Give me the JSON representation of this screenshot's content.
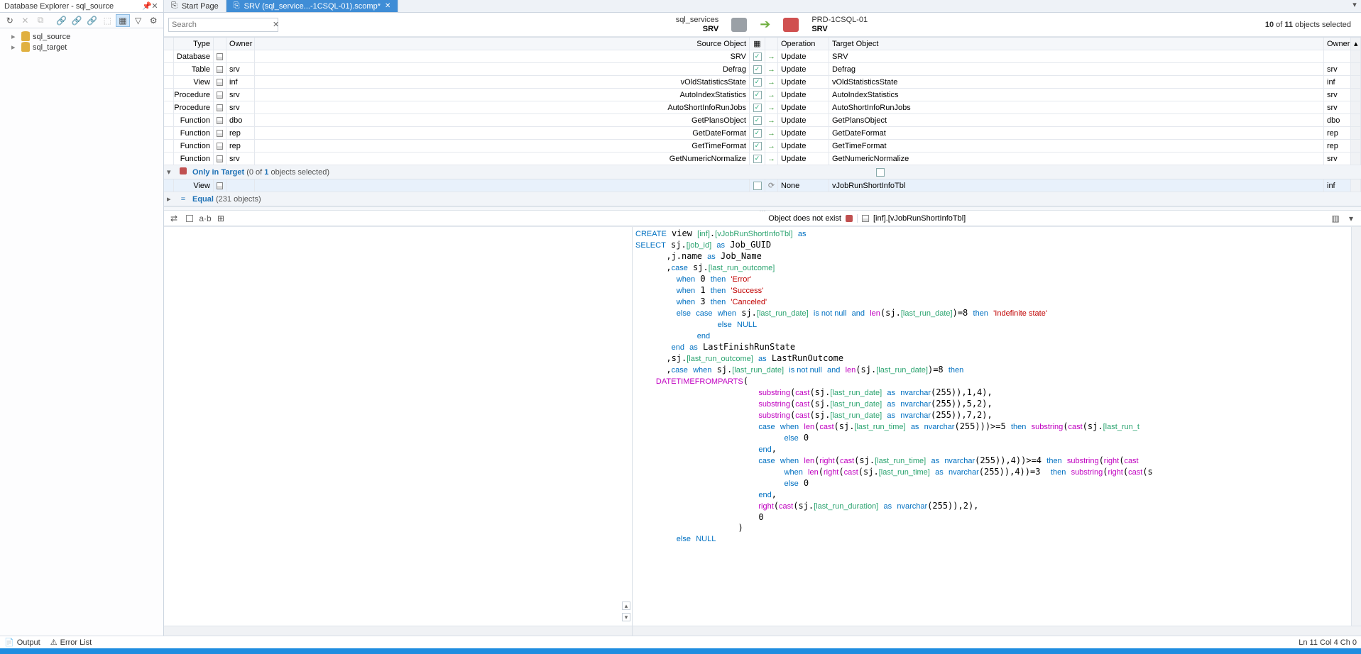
{
  "explorer_title": "Database Explorer - sql_source",
  "doc_tabs": [
    {
      "label": "Start Page",
      "active": false
    },
    {
      "label": "SRV (sql_service...-1CSQL-01).scomp*",
      "active": true
    }
  ],
  "tree": [
    {
      "label": "sql_source"
    },
    {
      "label": "sql_target"
    }
  ],
  "search_placeholder": "Search",
  "source": {
    "name": "sql_services",
    "node": "SRV"
  },
  "target": {
    "name": "PRD-1CSQL-01",
    "node": "SRV"
  },
  "count_html": {
    "a": "10",
    "b": "11",
    "suffix": "objects selected"
  },
  "columns": {
    "type": "Type",
    "owner": "Owner",
    "srcobj": "Source Object",
    "op": "Operation",
    "tgt": "Target Object",
    "towner": "Owner"
  },
  "rows": [
    {
      "type": "Database",
      "owner": "",
      "src": "SRV",
      "chk": true,
      "op": "Update",
      "tgt": "SRV",
      "towner": ""
    },
    {
      "type": "Table",
      "owner": "srv",
      "src": "Defrag",
      "chk": true,
      "op": "Update",
      "tgt": "Defrag",
      "towner": "srv"
    },
    {
      "type": "View",
      "owner": "inf",
      "src": "vOldStatisticsState",
      "chk": true,
      "op": "Update",
      "tgt": "vOldStatisticsState",
      "towner": "inf"
    },
    {
      "type": "Procedure",
      "owner": "srv",
      "src": "AutoIndexStatistics",
      "chk": true,
      "op": "Update",
      "tgt": "AutoIndexStatistics",
      "towner": "srv"
    },
    {
      "type": "Procedure",
      "owner": "srv",
      "src": "AutoShortInfoRunJobs",
      "chk": true,
      "op": "Update",
      "tgt": "AutoShortInfoRunJobs",
      "towner": "srv"
    },
    {
      "type": "Function",
      "owner": "dbo",
      "src": "GetPlansObject",
      "chk": true,
      "op": "Update",
      "tgt": "GetPlansObject",
      "towner": "dbo"
    },
    {
      "type": "Function",
      "owner": "rep",
      "src": "GetDateFormat",
      "chk": true,
      "op": "Update",
      "tgt": "GetDateFormat",
      "towner": "rep"
    },
    {
      "type": "Function",
      "owner": "rep",
      "src": "GetTimeFormat",
      "chk": true,
      "op": "Update",
      "tgt": "GetTimeFormat",
      "towner": "rep"
    },
    {
      "type": "Function",
      "owner": "srv",
      "src": "GetNumericNormalize",
      "chk": true,
      "op": "Update",
      "tgt": "GetNumericNormalize",
      "towner": "srv"
    }
  ],
  "only_target": {
    "label": "Only in Target",
    "detail_prefix": "(0 of ",
    "detail_n": "1",
    "detail_suffix": " objects selected)"
  },
  "only_target_row": {
    "type": "View",
    "op": "None",
    "tgt": "vJobRunShortInfoTbl",
    "towner": "inf"
  },
  "equal": {
    "label": "Equal",
    "count": "(231 objects)"
  },
  "left_diff_msg": "Object does not exist",
  "right_diff_title": "[inf].[vJobRunShortInfoTbl]",
  "status": {
    "output": "Output",
    "errors": "Error List",
    "pos": "Ln 11    Col 4    Ch 0"
  },
  "sql_lines": [
    [
      {
        "t": "CREATE",
        "c": "kw"
      },
      {
        "t": " view "
      },
      {
        "t": "[inf]",
        "c": "id"
      },
      {
        "t": "."
      },
      {
        "t": "[vJobRunShortInfoTbl]",
        "c": "id"
      },
      {
        "t": " "
      },
      {
        "t": "as",
        "c": "kw"
      }
    ],
    [
      {
        "t": "SELECT",
        "c": "kw"
      },
      {
        "t": " sj."
      },
      {
        "t": "[job_id]",
        "c": "id"
      },
      {
        "t": " "
      },
      {
        "t": "as",
        "c": "kw"
      },
      {
        "t": " Job_GUID"
      }
    ],
    [
      {
        "t": "      ,j.name "
      },
      {
        "t": "as",
        "c": "kw"
      },
      {
        "t": " Job_Name"
      }
    ],
    [
      {
        "t": "      ,"
      },
      {
        "t": "case",
        "c": "kw"
      },
      {
        "t": " sj."
      },
      {
        "t": "[last_run_outcome]",
        "c": "id"
      }
    ],
    [
      {
        "t": "        "
      },
      {
        "t": "when",
        "c": "kw"
      },
      {
        "t": " 0 "
      },
      {
        "t": "then",
        "c": "kw"
      },
      {
        "t": " "
      },
      {
        "t": "'Error'",
        "c": "str"
      }
    ],
    [
      {
        "t": "        "
      },
      {
        "t": "when",
        "c": "kw"
      },
      {
        "t": " 1 "
      },
      {
        "t": "then",
        "c": "kw"
      },
      {
        "t": " "
      },
      {
        "t": "'Success'",
        "c": "str"
      }
    ],
    [
      {
        "t": "        "
      },
      {
        "t": "when",
        "c": "kw"
      },
      {
        "t": " 3 "
      },
      {
        "t": "then",
        "c": "kw"
      },
      {
        "t": " "
      },
      {
        "t": "'Canceled'",
        "c": "str"
      }
    ],
    [
      {
        "t": "        "
      },
      {
        "t": "else",
        "c": "kw"
      },
      {
        "t": " "
      },
      {
        "t": "case",
        "c": "kw"
      },
      {
        "t": " "
      },
      {
        "t": "when",
        "c": "kw"
      },
      {
        "t": " sj."
      },
      {
        "t": "[last_run_date]",
        "c": "id"
      },
      {
        "t": " "
      },
      {
        "t": "is not null",
        "c": "kw"
      },
      {
        "t": " "
      },
      {
        "t": "and",
        "c": "kw"
      },
      {
        "t": " "
      },
      {
        "t": "len",
        "c": "fn"
      },
      {
        "t": "(sj."
      },
      {
        "t": "[last_run_date]",
        "c": "id"
      },
      {
        "t": ")=8 "
      },
      {
        "t": "then",
        "c": "kw"
      },
      {
        "t": " "
      },
      {
        "t": "'Indefinite state'",
        "c": "str"
      }
    ],
    [
      {
        "t": "                "
      },
      {
        "t": "else",
        "c": "kw"
      },
      {
        "t": " "
      },
      {
        "t": "NULL",
        "c": "kw"
      }
    ],
    [
      {
        "t": "            "
      },
      {
        "t": "end",
        "c": "kw"
      }
    ],
    [
      {
        "t": "       "
      },
      {
        "t": "end",
        "c": "kw"
      },
      {
        "t": " "
      },
      {
        "t": "as",
        "c": "kw"
      },
      {
        "t": " LastFinishRunState"
      }
    ],
    [
      {
        "t": "      ,sj."
      },
      {
        "t": "[last_run_outcome]",
        "c": "id"
      },
      {
        "t": " "
      },
      {
        "t": "as",
        "c": "kw"
      },
      {
        "t": " LastRunOutcome"
      }
    ],
    [
      {
        "t": "      ,"
      },
      {
        "t": "case",
        "c": "kw"
      },
      {
        "t": " "
      },
      {
        "t": "when",
        "c": "kw"
      },
      {
        "t": " sj."
      },
      {
        "t": "[last_run_date]",
        "c": "id"
      },
      {
        "t": " "
      },
      {
        "t": "is not null",
        "c": "kw"
      },
      {
        "t": " "
      },
      {
        "t": "and",
        "c": "kw"
      },
      {
        "t": " "
      },
      {
        "t": "len",
        "c": "fn"
      },
      {
        "t": "(sj."
      },
      {
        "t": "[last_run_date]",
        "c": "id"
      },
      {
        "t": ")=8 "
      },
      {
        "t": "then",
        "c": "kw"
      }
    ],
    [
      {
        "t": "    "
      },
      {
        "t": "DATETIMEFROMPARTS",
        "c": "fn"
      },
      {
        "t": "("
      }
    ],
    [
      {
        "t": "                        "
      },
      {
        "t": "substring",
        "c": "fn"
      },
      {
        "t": "("
      },
      {
        "t": "cast",
        "c": "fn"
      },
      {
        "t": "(sj."
      },
      {
        "t": "[last_run_date]",
        "c": "id"
      },
      {
        "t": " "
      },
      {
        "t": "as",
        "c": "kw"
      },
      {
        "t": " "
      },
      {
        "t": "nvarchar",
        "c": "kw"
      },
      {
        "t": "(255)),1,4),"
      }
    ],
    [
      {
        "t": "                        "
      },
      {
        "t": "substring",
        "c": "fn"
      },
      {
        "t": "("
      },
      {
        "t": "cast",
        "c": "fn"
      },
      {
        "t": "(sj."
      },
      {
        "t": "[last_run_date]",
        "c": "id"
      },
      {
        "t": " "
      },
      {
        "t": "as",
        "c": "kw"
      },
      {
        "t": " "
      },
      {
        "t": "nvarchar",
        "c": "kw"
      },
      {
        "t": "(255)),5,2),"
      }
    ],
    [
      {
        "t": "                        "
      },
      {
        "t": "substring",
        "c": "fn"
      },
      {
        "t": "("
      },
      {
        "t": "cast",
        "c": "fn"
      },
      {
        "t": "(sj."
      },
      {
        "t": "[last_run_date]",
        "c": "id"
      },
      {
        "t": " "
      },
      {
        "t": "as",
        "c": "kw"
      },
      {
        "t": " "
      },
      {
        "t": "nvarchar",
        "c": "kw"
      },
      {
        "t": "(255)),7,2),"
      }
    ],
    [
      {
        "t": "                        "
      },
      {
        "t": "case",
        "c": "kw"
      },
      {
        "t": " "
      },
      {
        "t": "when",
        "c": "kw"
      },
      {
        "t": " "
      },
      {
        "t": "len",
        "c": "fn"
      },
      {
        "t": "("
      },
      {
        "t": "cast",
        "c": "fn"
      },
      {
        "t": "(sj."
      },
      {
        "t": "[last_run_time]",
        "c": "id"
      },
      {
        "t": " "
      },
      {
        "t": "as",
        "c": "kw"
      },
      {
        "t": " "
      },
      {
        "t": "nvarchar",
        "c": "kw"
      },
      {
        "t": "(255)))>=5 "
      },
      {
        "t": "then",
        "c": "kw"
      },
      {
        "t": " "
      },
      {
        "t": "substring",
        "c": "fn"
      },
      {
        "t": "("
      },
      {
        "t": "cast",
        "c": "fn"
      },
      {
        "t": "(sj."
      },
      {
        "t": "[last_run_t",
        "c": "id"
      }
    ],
    [
      {
        "t": "                             "
      },
      {
        "t": "else",
        "c": "kw"
      },
      {
        "t": " 0"
      }
    ],
    [
      {
        "t": "                        "
      },
      {
        "t": "end",
        "c": "kw"
      },
      {
        "t": ","
      }
    ],
    [
      {
        "t": "                        "
      },
      {
        "t": "case",
        "c": "kw"
      },
      {
        "t": " "
      },
      {
        "t": "when",
        "c": "kw"
      },
      {
        "t": " "
      },
      {
        "t": "len",
        "c": "fn"
      },
      {
        "t": "("
      },
      {
        "t": "right",
        "c": "fn"
      },
      {
        "t": "("
      },
      {
        "t": "cast",
        "c": "fn"
      },
      {
        "t": "(sj."
      },
      {
        "t": "[last_run_time]",
        "c": "id"
      },
      {
        "t": " "
      },
      {
        "t": "as",
        "c": "kw"
      },
      {
        "t": " "
      },
      {
        "t": "nvarchar",
        "c": "kw"
      },
      {
        "t": "(255)),4))>=4 "
      },
      {
        "t": "then",
        "c": "kw"
      },
      {
        "t": " "
      },
      {
        "t": "substring",
        "c": "fn"
      },
      {
        "t": "("
      },
      {
        "t": "right",
        "c": "fn"
      },
      {
        "t": "("
      },
      {
        "t": "cast",
        "c": "fn"
      }
    ],
    [
      {
        "t": "                             "
      },
      {
        "t": "when",
        "c": "kw"
      },
      {
        "t": " "
      },
      {
        "t": "len",
        "c": "fn"
      },
      {
        "t": "("
      },
      {
        "t": "right",
        "c": "fn"
      },
      {
        "t": "("
      },
      {
        "t": "cast",
        "c": "fn"
      },
      {
        "t": "(sj."
      },
      {
        "t": "[last_run_time]",
        "c": "id"
      },
      {
        "t": " "
      },
      {
        "t": "as",
        "c": "kw"
      },
      {
        "t": " "
      },
      {
        "t": "nvarchar",
        "c": "kw"
      },
      {
        "t": "(255)),4))=3  "
      },
      {
        "t": "then",
        "c": "kw"
      },
      {
        "t": " "
      },
      {
        "t": "substring",
        "c": "fn"
      },
      {
        "t": "("
      },
      {
        "t": "right",
        "c": "fn"
      },
      {
        "t": "("
      },
      {
        "t": "cast",
        "c": "fn"
      },
      {
        "t": "(s"
      }
    ],
    [
      {
        "t": "                             "
      },
      {
        "t": "else",
        "c": "kw"
      },
      {
        "t": " 0"
      }
    ],
    [
      {
        "t": "                        "
      },
      {
        "t": "end",
        "c": "kw"
      },
      {
        "t": ","
      }
    ],
    [
      {
        "t": "                        "
      },
      {
        "t": "right",
        "c": "fn"
      },
      {
        "t": "("
      },
      {
        "t": "cast",
        "c": "fn"
      },
      {
        "t": "(sj."
      },
      {
        "t": "[last_run_duration]",
        "c": "id"
      },
      {
        "t": " "
      },
      {
        "t": "as",
        "c": "kw"
      },
      {
        "t": " "
      },
      {
        "t": "nvarchar",
        "c": "kw"
      },
      {
        "t": "(255)),2),"
      }
    ],
    [
      {
        "t": "                        0"
      }
    ],
    [
      {
        "t": "                    )"
      }
    ],
    [
      {
        "t": "        "
      },
      {
        "t": "else",
        "c": "kw"
      },
      {
        "t": " "
      },
      {
        "t": "NULL",
        "c": "kw"
      }
    ]
  ]
}
